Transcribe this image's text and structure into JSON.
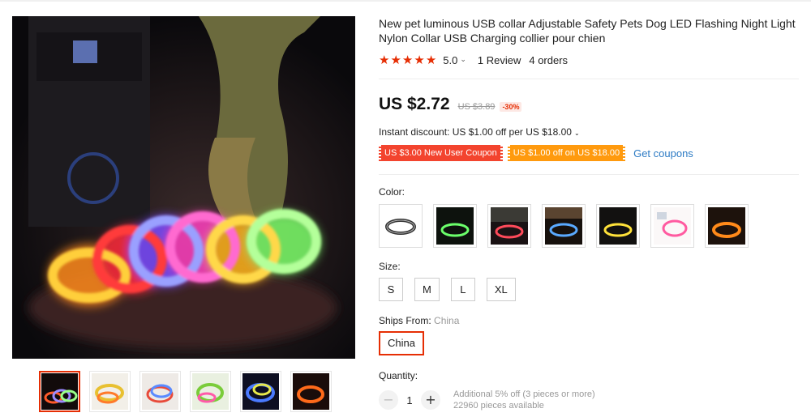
{
  "product": {
    "title": "New pet luminous USB collar Adjustable Safety Pets Dog LED Flashing Night Light Nylon Collar USB Charging collier pour chien",
    "rating": "5.0",
    "reviews": "1 Review",
    "orders": "4 orders"
  },
  "price": {
    "current": "US $2.72",
    "original": "US $3.89",
    "discount": "-30%"
  },
  "promo": {
    "instant_discount": "Instant discount: US $1.00 off per US $18.00",
    "coupons": [
      "US $3.00 New User Coupon",
      "US $1.00 off on US $18.00"
    ],
    "get_coupons": "Get coupons"
  },
  "options": {
    "color_label": "Color:",
    "size_label": "Size:",
    "sizes": [
      "S",
      "M",
      "L",
      "XL"
    ],
    "ships_from_label": "Ships From:",
    "ships_from_value": "China",
    "ship_option": "China"
  },
  "quantity": {
    "label": "Quantity:",
    "value": "1",
    "note_line1": "Additional 5% off (3 pieces or more)",
    "note_line2": "22960 pieces available"
  },
  "icons": {
    "star": "star-icon",
    "chevron": "chevron-down-icon",
    "minus": "minus-icon",
    "plus": "plus-icon"
  },
  "colors": {
    "accent": "#e62e04",
    "coupon_red": "#f3442e",
    "coupon_orange": "#ff9a0e",
    "link": "#2d7bc4"
  }
}
